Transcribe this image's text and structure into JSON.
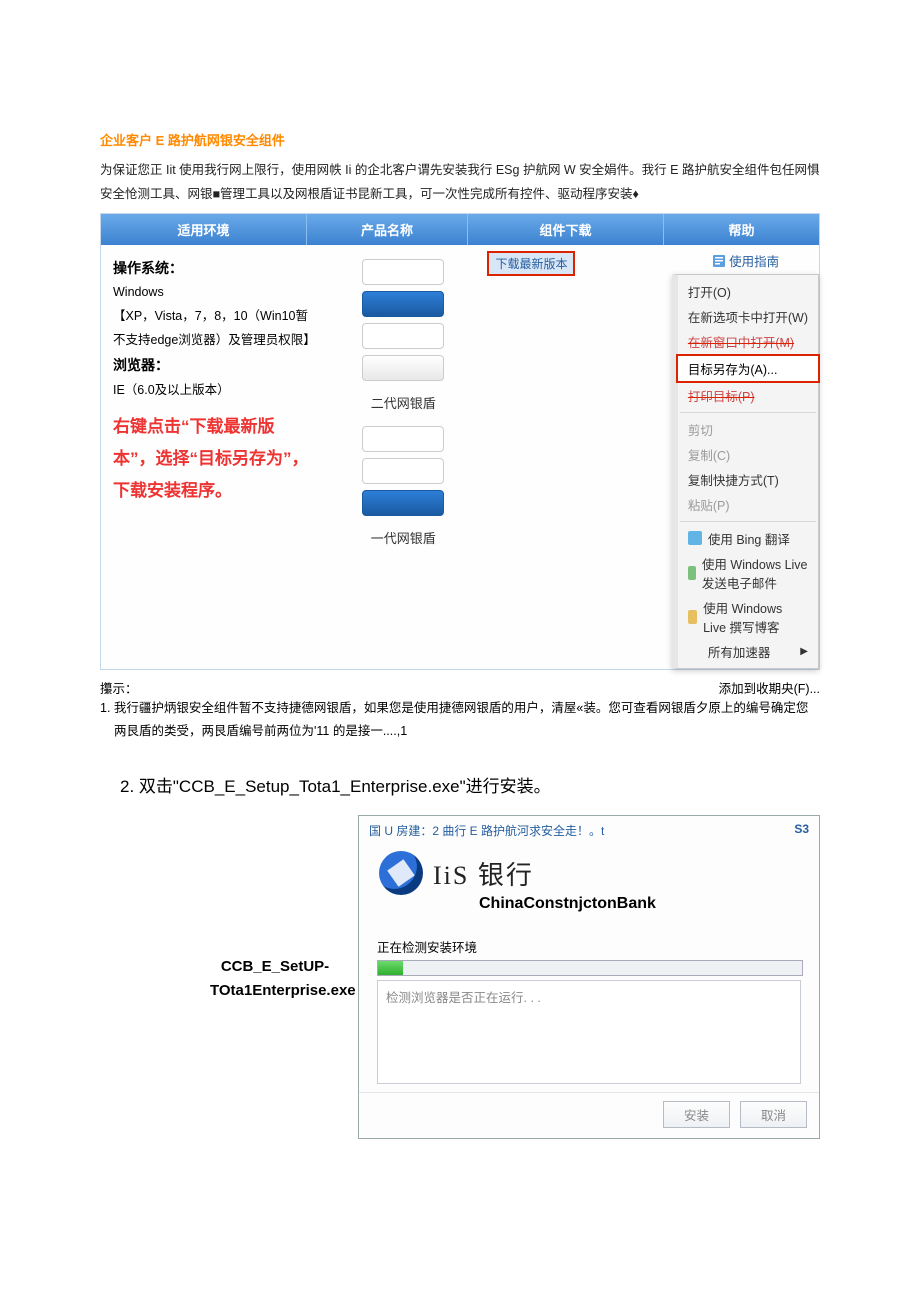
{
  "title": "企业客户 E 路护航网银安全组件",
  "intro": "为保证您正 Iit 使用我行网上限行，使用网帙 Ii 的企北客户谓先安装我行 ESg 护航网 W 安全娟件。我行 E 路护航安全组件包任网惧安全怆测工具、网银■管理工具以及网根盾证书昆新工具，可一次性完成所有控件、驱动程序安装♦",
  "tabs": {
    "env": "适用环境",
    "name": "产品名称",
    "dl": "组件下载",
    "help": "帮助"
  },
  "env": {
    "os_title": "操作系统：",
    "os_line1": "Windows",
    "os_line2": "【XP，Vista，7，8，10（Win10暂不支持edge浏览器）及管理员权限】",
    "browser_title": "浏览器：",
    "browser_line": "IE（6.0及以上版本）",
    "red": "右键点击“下载最新版本”，选择“目标另存为”，下载安装程序。"
  },
  "product": {
    "gen2": "二代网银盾",
    "gen1": "一代网银盾"
  },
  "download_btn": "下载最新版本",
  "guide": "使用指南",
  "ctx": {
    "open": "打开(O)",
    "newtab": "在新选项卡中打开(W)",
    "newwin_struck": "在新窗口中打开(M)",
    "saveas": "目标另存为(A)...",
    "print_struck": "打印目标(P)",
    "cut": "剪切",
    "copy": "复制(C)",
    "copyshort": "复制快捷方式(T)",
    "paste": "粘贴(P)",
    "bing": "使用 Bing 翻译",
    "live_mail": "使用 Windows Live 发送电子邮件",
    "live_blog": "使用 Windows Live 撰写博客",
    "accel": "所有加速器"
  },
  "hint_label": "攥示：",
  "fav": "添加到收期央(F)...",
  "hint_body": "1. 我行疆护炳银安全组件暂不支持捷德网银盾，如果您是使用捷德网银盾的用户，清屋«装。您可查看网银盾夕原上的编号确定您两艮盾的类受，两艮盾编号前两位为'11 的是接一....,1",
  "step2": "2. 双击\"CCB_E_Setup_Tota1_Enterprise.exe\"进行安装。",
  "exe_label": "CCB_E_SetUP-TOta1Enterprise.exe",
  "installer": {
    "topbar": "国 U 房建：2 曲行 E 路护航河求安全走！。t",
    "s3": "S3",
    "logo_cn": "IiS 银行",
    "logo_en": "ChinaConstnjctonBank",
    "status": "正在检测安装环境",
    "log": "检测浏览器是否正在运行. . .",
    "install": "安装",
    "cancel": "取消"
  }
}
